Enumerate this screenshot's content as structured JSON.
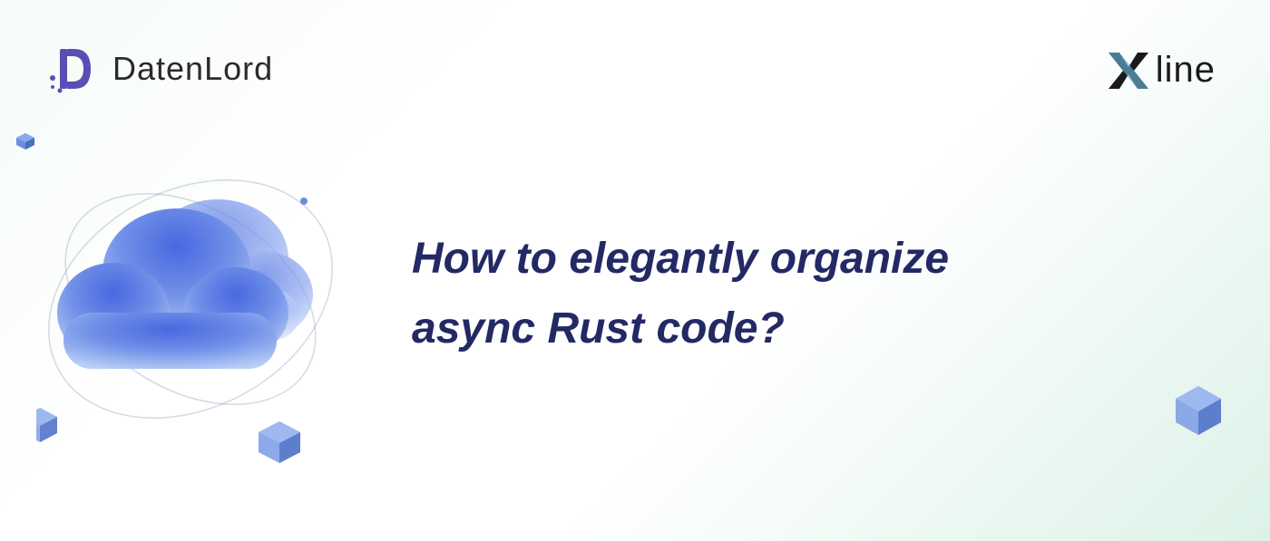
{
  "logos": {
    "datenlord": {
      "text": "DatenLord"
    },
    "xline": {
      "text": "line"
    }
  },
  "heading": {
    "line1": "How to elegantly organize",
    "line2": "async Rust code?"
  },
  "colors": {
    "heading": "#232965",
    "datenlord_purple": "#5b4db3",
    "xline_accent": "#5fa8c9",
    "cloud_blue_light": "#a8c5f0",
    "cloud_blue_dark": "#4060d8",
    "cube_blue": "#6a8de0"
  }
}
